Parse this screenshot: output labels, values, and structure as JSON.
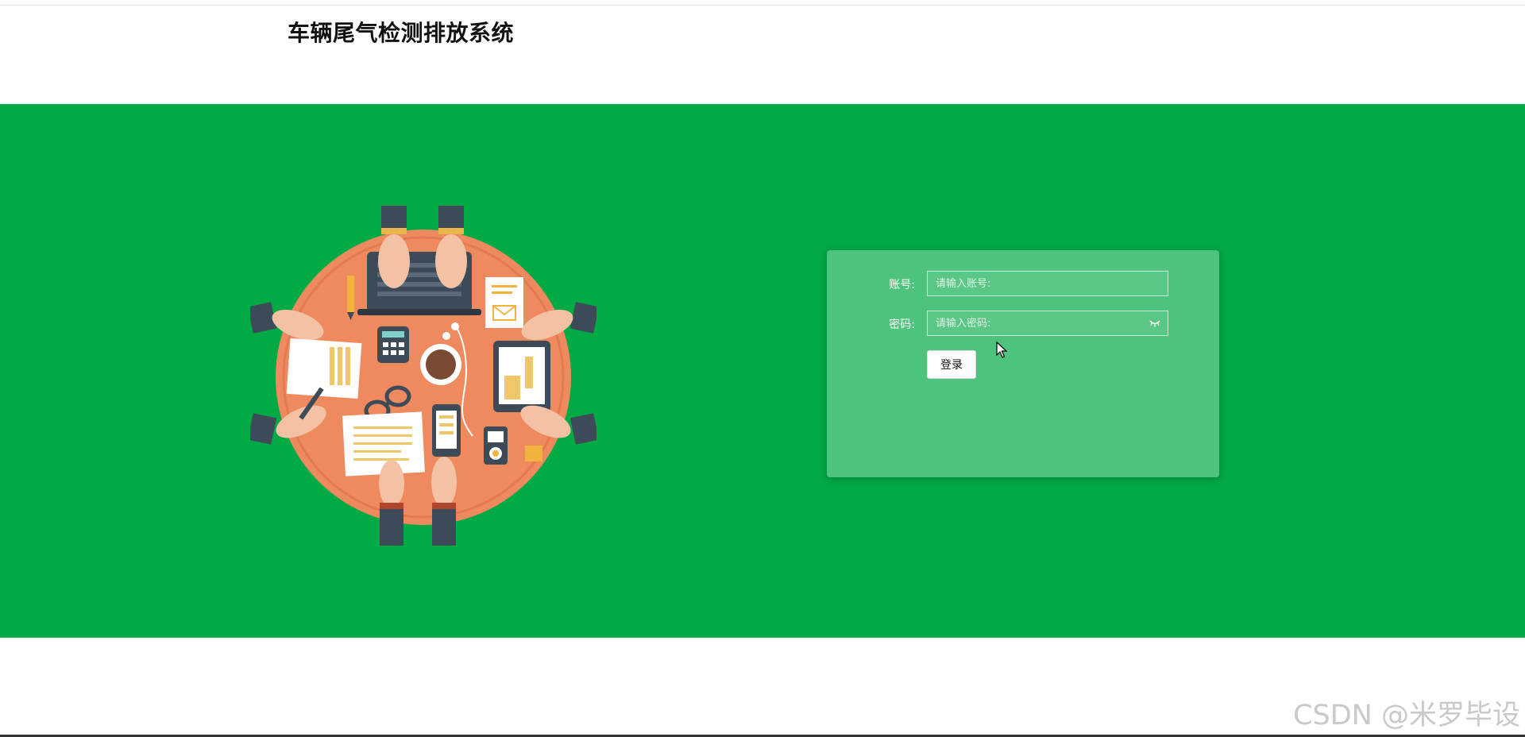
{
  "header": {
    "title": "车辆尾气检测排放系统"
  },
  "colors": {
    "banner": "#02aa45",
    "illustration_circle": "#ee8a5e",
    "sleeve": "#3d4a57",
    "skin": "#f3c1a4"
  },
  "illustration": {
    "icon": "team-meeting-table-illustration"
  },
  "login": {
    "account_label": "账号:",
    "account_placeholder": "请输入账号:",
    "password_label": "密码:",
    "password_placeholder": "请输入密码:",
    "password_toggle_icon": "eye-closed-icon",
    "submit_label": "登录"
  },
  "watermark": "CSDN @米罗毕设"
}
